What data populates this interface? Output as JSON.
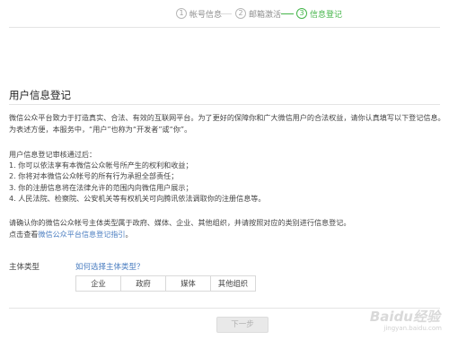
{
  "steps": [
    {
      "num": "1",
      "label": "帐号信息",
      "state": "done"
    },
    {
      "num": "2",
      "label": "邮箱激活",
      "state": "done"
    },
    {
      "num": "3",
      "label": "信息登记",
      "state": "active"
    }
  ],
  "colors": {
    "accent": "#44b549",
    "link": "#4a7dc0"
  },
  "title": "用户信息登记",
  "intro": {
    "line1": "微信公众平台致力于打造真实、合法、有效的互联网平台。为了更好的保障你和广大微信用户的合法权益，请你认真填写以下登记信息。",
    "line2": "为表述方便，本服务中，“用户”也称为“开发者”或“你”。"
  },
  "review": {
    "heading": "用户信息登记审核通过后：",
    "items": [
      "1. 你可以依法享有本微信公众帐号所产生的权利和收益；",
      "2. 你将对本微信公众帐号的所有行为承担全部责任；",
      "3. 你的注册信息将在法律允许的范围内向微信用户展示；",
      "4. 人民法院、检察院、公安机关等有权机关可向腾讯依法调取你的注册信息等。"
    ]
  },
  "confirm": {
    "line1": "请确认你的微信公众帐号主体类型属于政府、媒体、企业、其他组织，并请按照对应的类别进行信息登记。",
    "guide_prefix": "点击查看",
    "guide_link": "微信公众平台信息登记指引",
    "guide_suffix": "。"
  },
  "subject": {
    "label": "主体类型",
    "help_link": "如何选择主体类型？",
    "options": [
      "企业",
      "政府",
      "媒体",
      "其他组织"
    ]
  },
  "next_button": "下一步",
  "watermark": {
    "brand": "Baidu经验",
    "url": "jingyan.baidu.com"
  }
}
